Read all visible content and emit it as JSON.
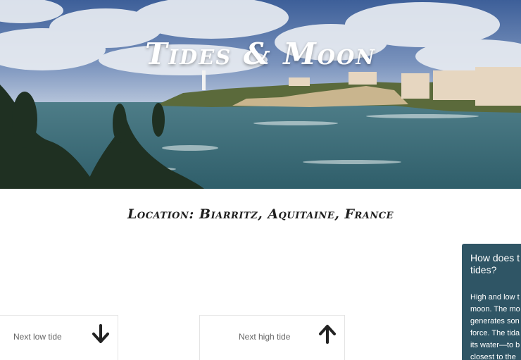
{
  "hero": {
    "title": "Tides & Moon"
  },
  "location": {
    "text": "Location: Biarritz, Aquitaine, France"
  },
  "tides": {
    "low": {
      "label": "Next low tide",
      "icon": "arrow-down-icon"
    },
    "high": {
      "label": "Next high tide",
      "icon": "arrow-up-icon"
    }
  },
  "info_panel": {
    "title_lines": [
      "How does t",
      "tides?"
    ],
    "body_lines": [
      "High and low t",
      "moon. The mo",
      "generates son",
      "force. The tida",
      "its water—to b",
      "closest to the"
    ]
  },
  "colors": {
    "panel": "#2f5565",
    "text": "#1f1f1f"
  }
}
